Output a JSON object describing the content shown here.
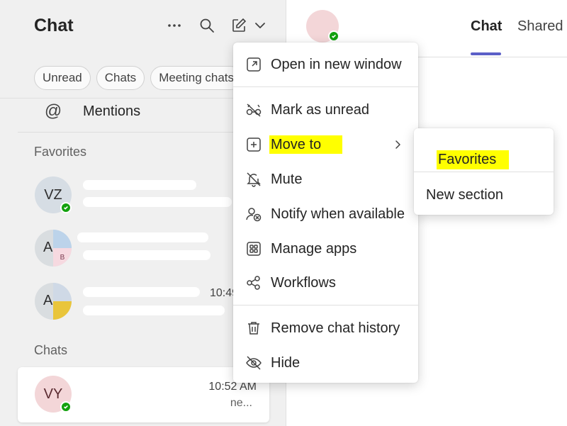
{
  "header": {
    "title": "Chat",
    "icons": [
      "more-icon",
      "search-icon",
      "compose-icon",
      "chevron-down-icon"
    ]
  },
  "filters": [
    "Unread",
    "Chats",
    "Meeting chats"
  ],
  "mentions": {
    "symbol": "@",
    "label": "Mentions"
  },
  "sections": {
    "favorites": "Favorites",
    "chats": "Chats"
  },
  "chat_list": [
    {
      "initials": "VZ",
      "time": "",
      "preview": "",
      "status": "available"
    },
    {
      "initials": "A",
      "time": "",
      "preview": "",
      "badge": "B"
    },
    {
      "initials": "A",
      "time": "10:49",
      "preview": ""
    },
    {
      "initials": "VY",
      "time": "10:52 AM",
      "preview": "ne...",
      "status": "available",
      "selected": true
    }
  ],
  "right_header": {
    "tabs": [
      {
        "label": "Chat",
        "active": true
      },
      {
        "label": "Shared",
        "active": false
      }
    ]
  },
  "context_menu": {
    "items": [
      {
        "label": "Open in new window",
        "icon": "open-new-window-icon"
      },
      {
        "label": "Mark as unread",
        "icon": "mark-unread-icon"
      },
      {
        "label": "Move to",
        "icon": "move-to-icon",
        "has_submenu": true,
        "highlighted": true
      },
      {
        "label": "Mute",
        "icon": "mute-bell-icon"
      },
      {
        "label": "Notify when available",
        "icon": "notify-available-icon"
      },
      {
        "label": "Manage apps",
        "icon": "manage-apps-icon"
      },
      {
        "label": "Workflows",
        "icon": "workflows-icon"
      },
      {
        "label": "Remove chat history",
        "icon": "trash-icon"
      },
      {
        "label": "Hide",
        "icon": "hide-eye-icon"
      }
    ]
  },
  "submenu": {
    "items": [
      {
        "label": "Favorites",
        "highlighted": true
      },
      {
        "label": "New section"
      }
    ]
  },
  "colors": {
    "accent": "#5b5fc7",
    "presence": "#13a10e",
    "highlight": "#ffff00",
    "pane_bg": "#f0f0f0"
  }
}
